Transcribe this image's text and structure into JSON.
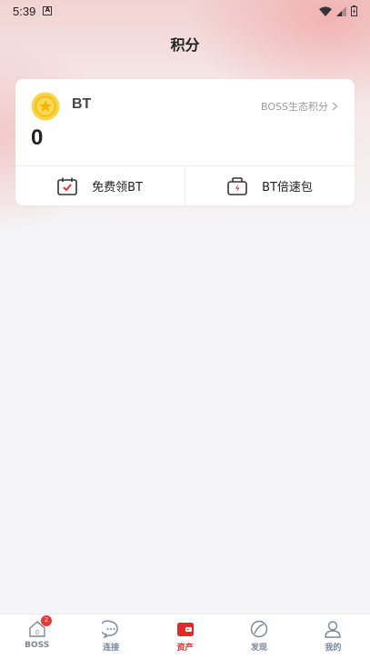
{
  "status_bar": {
    "time": "5:39"
  },
  "header": {
    "title": "积分"
  },
  "card": {
    "token_name": "BT",
    "balance": "0",
    "eco_link_label": "BOSS生态积分",
    "actions": [
      {
        "label": "免费领BT",
        "icon": "calendar-check-icon"
      },
      {
        "label": "BT倍速包",
        "icon": "speed-pack-icon"
      }
    ]
  },
  "tabbar": {
    "items": [
      {
        "label": "BOSS",
        "icon": "home-icon",
        "badge": "2",
        "active": false
      },
      {
        "label": "连接",
        "icon": "chat-icon",
        "active": false
      },
      {
        "label": "资产",
        "icon": "wallet-icon",
        "active": true
      },
      {
        "label": "发现",
        "icon": "compass-icon",
        "active": false
      },
      {
        "label": "我的",
        "icon": "profile-icon",
        "active": false
      }
    ]
  },
  "colors": {
    "accent": "#e02a2a",
    "coin": "#f6c21c",
    "tab_inactive": "#7a8596"
  }
}
